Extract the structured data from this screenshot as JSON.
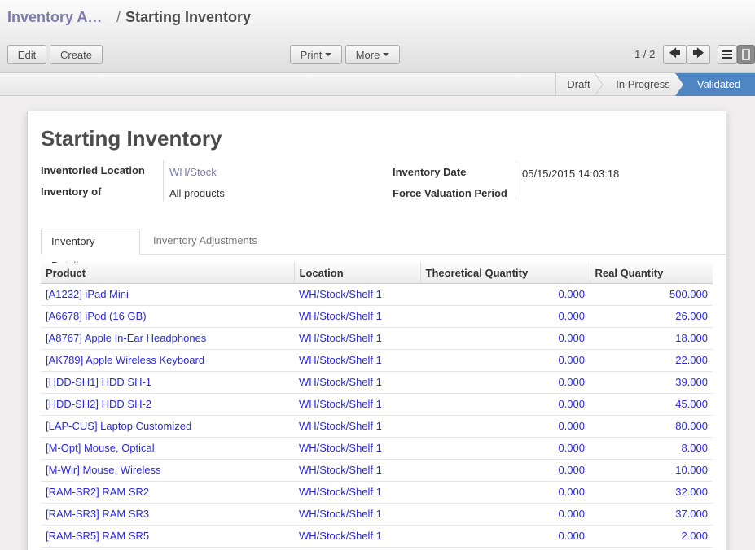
{
  "breadcrumb": {
    "parent": "Inventory A…",
    "separator": "/",
    "current": "Starting Inventory"
  },
  "buttons": {
    "edit": "Edit",
    "create": "Create",
    "print": "Print",
    "more": "More"
  },
  "pager": {
    "text": "1 / 2"
  },
  "status_stages": [
    "Draft",
    "In Progress",
    "Validated"
  ],
  "active_stage": "Validated",
  "form": {
    "title": "Starting Inventory",
    "inventoried_location_label": "Inventoried Location",
    "inventoried_location_value": "WH/Stock",
    "inventory_of_label": "Inventory of",
    "inventory_of_value": "All products",
    "inventory_date_label": "Inventory Date",
    "inventory_date_value": "05/15/2015 14:03:18",
    "force_valuation_label": "Force Valuation Period",
    "force_valuation_value": ""
  },
  "tabs": [
    "Inventory Details",
    "Inventory Adjustments"
  ],
  "table": {
    "headers": [
      "Product",
      "Location",
      "Theoretical Quantity",
      "Real Quantity"
    ],
    "rows": [
      [
        "[A1232] iPad Mini",
        "WH/Stock/Shelf 1",
        "0.000",
        "500.000"
      ],
      [
        "[A6678] iPod (16 GB)",
        "WH/Stock/Shelf 1",
        "0.000",
        "26.000"
      ],
      [
        "[A8767] Apple In-Ear Headphones",
        "WH/Stock/Shelf 1",
        "0.000",
        "18.000"
      ],
      [
        "[AK789] Apple Wireless Keyboard",
        "WH/Stock/Shelf 1",
        "0.000",
        "22.000"
      ],
      [
        "[HDD-SH1] HDD SH-1",
        "WH/Stock/Shelf 1",
        "0.000",
        "39.000"
      ],
      [
        "[HDD-SH2] HDD SH-2",
        "WH/Stock/Shelf 1",
        "0.000",
        "45.000"
      ],
      [
        "[LAP-CUS] Laptop Customized",
        "WH/Stock/Shelf 1",
        "0.000",
        "80.000"
      ],
      [
        "[M-Opt] Mouse, Optical",
        "WH/Stock/Shelf 1",
        "0.000",
        "8.000"
      ],
      [
        "[M-Wir] Mouse, Wireless",
        "WH/Stock/Shelf 1",
        "0.000",
        "10.000"
      ],
      [
        "[RAM-SR2] RAM SR2",
        "WH/Stock/Shelf 1",
        "0.000",
        "32.000"
      ],
      [
        "[RAM-SR3] RAM SR3",
        "WH/Stock/Shelf 1",
        "0.000",
        "37.000"
      ],
      [
        "[RAM-SR5] RAM SR5",
        "WH/Stock/Shelf 1",
        "0.000",
        "2.000"
      ]
    ]
  },
  "icons": {
    "prev": "arrow-left-icon",
    "next": "arrow-right-icon",
    "list_view": "list-view-icon",
    "form_view": "form-view-icon"
  },
  "colors": {
    "accent": "#7c7bad",
    "status_active": "#4e86c4",
    "link": "#2a2adb"
  }
}
